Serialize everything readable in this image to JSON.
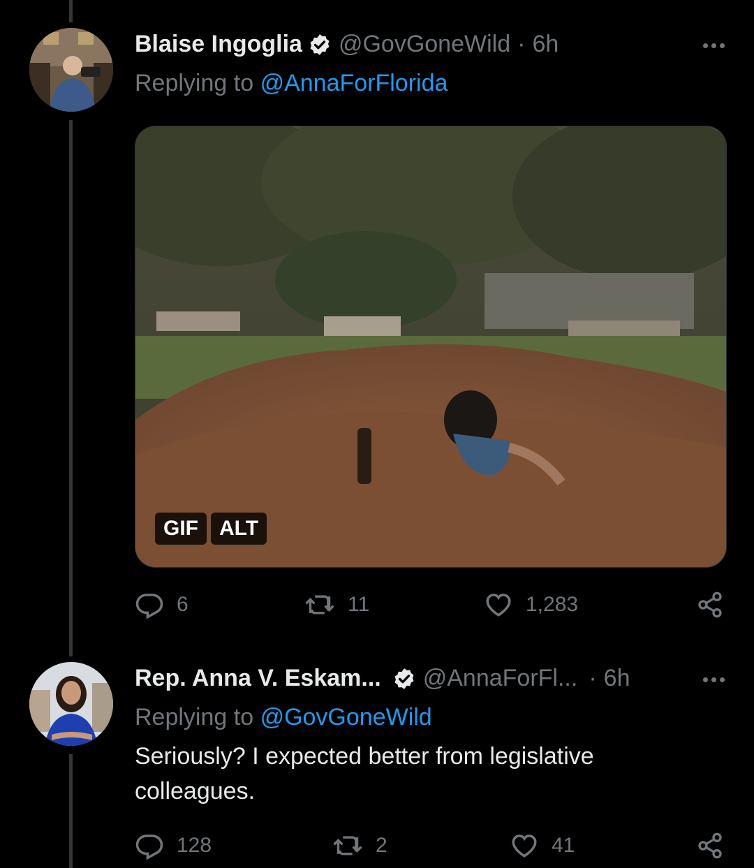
{
  "tweet1": {
    "name": "Blaise Ingoglia",
    "handle": "@GovGoneWild",
    "separator": "·",
    "time": "6h",
    "replying_prefix": "Replying to",
    "replying_handle": "@AnnaForFlorida",
    "media_badges": [
      "GIF",
      "ALT"
    ],
    "stats": {
      "replies": "6",
      "retweets": "11",
      "likes": "1,283"
    }
  },
  "tweet2": {
    "name": "Rep. Anna V. Eskam...",
    "handle": "@AnnaForFl...",
    "separator": "·",
    "time": "6h",
    "replying_prefix": "Replying to",
    "replying_handle": "@GovGoneWild",
    "text": "Seriously? I expected better from legislative colleagues.",
    "stats": {
      "replies": "128",
      "retweets": "2",
      "likes": "41"
    }
  },
  "colors": {
    "background": "#000000",
    "text": "#e7e9ea",
    "muted": "#71767b",
    "link": "#1d9bf0",
    "thread_line": "#333639"
  },
  "icons": [
    "verified-badge-icon",
    "more-icon",
    "reply-icon",
    "retweet-icon",
    "like-icon",
    "share-icon"
  ]
}
